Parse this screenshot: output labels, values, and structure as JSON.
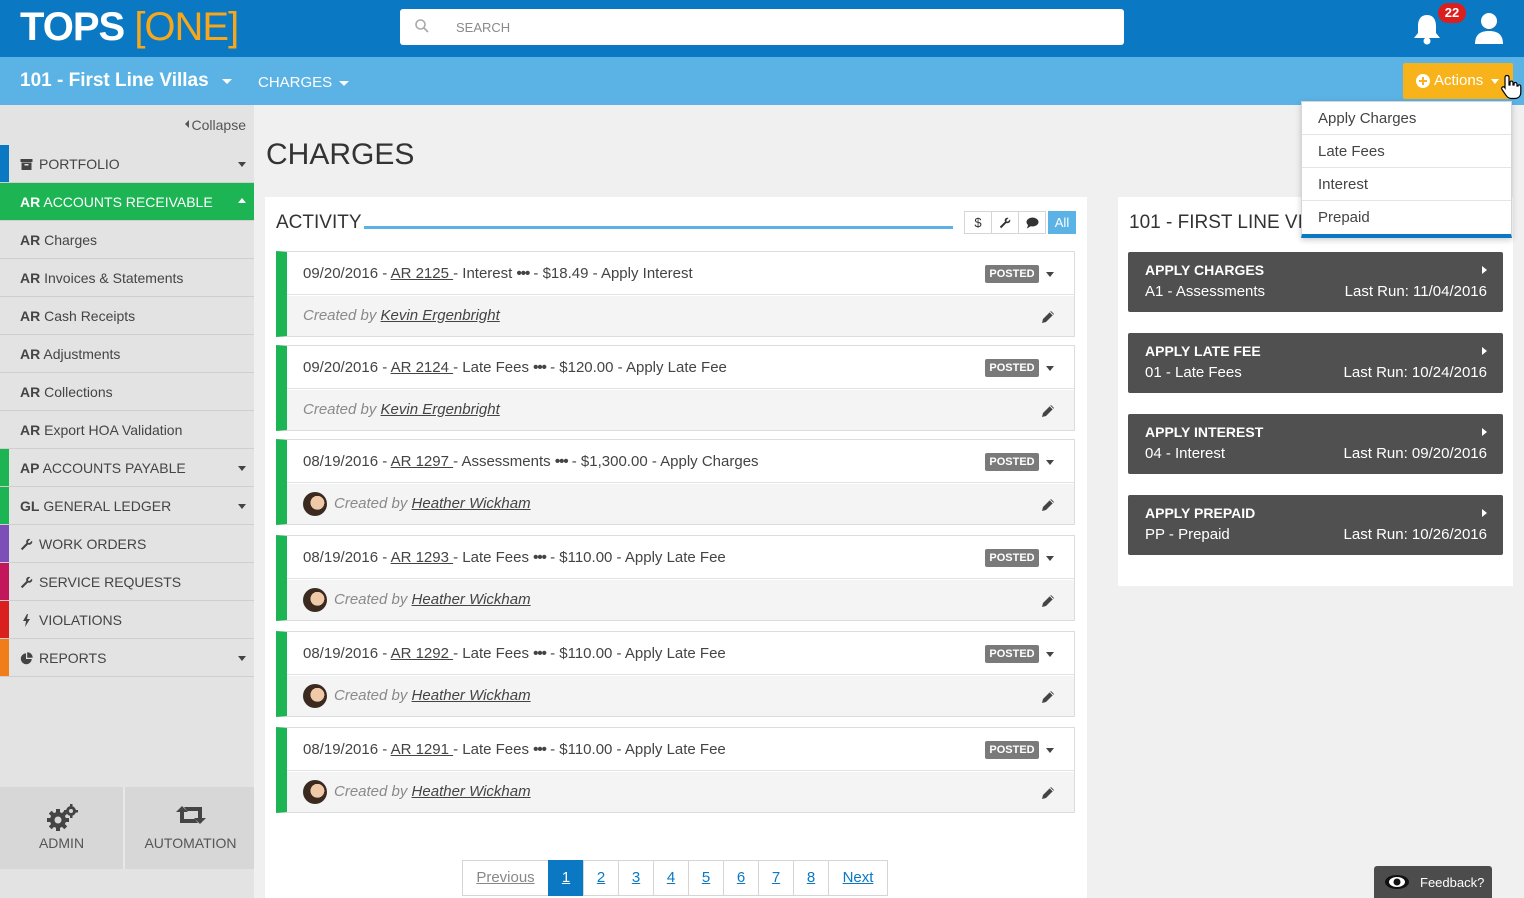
{
  "header": {
    "logo_main": "TOPS",
    "logo_one": "[ONE]",
    "search_placeholder": "SEARCH",
    "notifications": "22"
  },
  "subheader": {
    "property": "101 - First Line Villas",
    "section": "CHARGES",
    "actions_label": "Actions"
  },
  "actions_menu": [
    "Apply Charges",
    "Late Fees",
    "Interest",
    "Prepaid"
  ],
  "sidebar": {
    "collapse": "Collapse",
    "items": [
      {
        "prefix": "",
        "label": "PORTFOLIO",
        "icon": "archive-icon",
        "color": "#0a78c2",
        "dropdown": true
      },
      {
        "prefix": "AR",
        "label": "ACCOUNTS RECEIVABLE",
        "color": "#1db554",
        "dropdown": true,
        "active": true
      },
      {
        "prefix": "AR",
        "label": "Charges",
        "sub": true
      },
      {
        "prefix": "AR",
        "label": "Invoices & Statements",
        "sub": true
      },
      {
        "prefix": "AR",
        "label": "Cash Receipts",
        "sub": true
      },
      {
        "prefix": "AR",
        "label": "Adjustments",
        "sub": true
      },
      {
        "prefix": "AR",
        "label": "Collections",
        "sub": true
      },
      {
        "prefix": "AR",
        "label": "Export HOA Validation",
        "sub": true
      },
      {
        "prefix": "AP",
        "label": "ACCOUNTS PAYABLE",
        "color": "#1db554",
        "dropdown": true
      },
      {
        "prefix": "GL",
        "label": "GENERAL LEDGER",
        "color": "#1db554",
        "dropdown": true
      },
      {
        "prefix": "",
        "label": "WORK ORDERS",
        "icon": "wrench-icon",
        "color": "#7b4fb5"
      },
      {
        "prefix": "",
        "label": "SERVICE REQUESTS",
        "icon": "wrench-icon",
        "color": "#c2185b"
      },
      {
        "prefix": "",
        "label": "VIOLATIONS",
        "icon": "bolt-icon",
        "color": "#d9201e"
      },
      {
        "prefix": "",
        "label": "REPORTS",
        "icon": "pie-chart-icon",
        "color": "#f07d1a",
        "dropdown": true
      }
    ],
    "tiles": [
      {
        "label": "ADMIN",
        "icon": "gears-icon"
      },
      {
        "label": "AUTOMATION",
        "icon": "retweet-icon"
      }
    ]
  },
  "main": {
    "title": "CHARGES",
    "activity_title": "ACTIVITY",
    "filters": [
      "$",
      "wrench-icon",
      "comment-icon",
      "All"
    ],
    "entries": [
      {
        "date": "09/20/2016",
        "ref": "AR 2125",
        "type": "Interest",
        "amount": "$18.49",
        "desc": "Apply Interest",
        "status": "POSTED",
        "created_prefix": "Created by",
        "user": "Kevin Ergenbright",
        "avatar": false
      },
      {
        "date": "09/20/2016",
        "ref": "AR 2124",
        "type": "Late Fees",
        "amount": "$120.00",
        "desc": "Apply Late Fee",
        "status": "POSTED",
        "created_prefix": "Created by",
        "user": "Kevin Ergenbright",
        "avatar": false
      },
      {
        "date": "08/19/2016",
        "ref": "AR 1297",
        "type": "Assessments",
        "amount": "$1,300.00",
        "desc": "Apply Charges",
        "status": "POSTED",
        "created_prefix": "Created by",
        "user": "Heather Wickham",
        "avatar": true
      },
      {
        "date": "08/19/2016",
        "ref": "AR 1293",
        "type": "Late Fees",
        "amount": "$110.00",
        "desc": "Apply Late Fee",
        "status": "POSTED",
        "created_prefix": "Created by",
        "user": "Heather Wickham",
        "avatar": true
      },
      {
        "date": "08/19/2016",
        "ref": "AR 1292",
        "type": "Late Fees",
        "amount": "$110.00",
        "desc": "Apply Late Fee",
        "status": "POSTED",
        "created_prefix": "Created by",
        "user": "Heather Wickham",
        "avatar": true
      },
      {
        "date": "08/19/2016",
        "ref": "AR 1291",
        "type": "Late Fees",
        "amount": "$110.00",
        "desc": "Apply Late Fee",
        "status": "POSTED",
        "created_prefix": "Created by",
        "user": "Heather Wickham",
        "avatar": true
      }
    ],
    "pagination": {
      "previous": "Previous",
      "pages": [
        "1",
        "2",
        "3",
        "4",
        "5",
        "6",
        "7",
        "8"
      ],
      "current": "1",
      "next": "Next"
    }
  },
  "right_panel": {
    "title": "101 - FIRST LINE VILLAS",
    "cards": [
      {
        "title": "APPLY CHARGES",
        "sub": "A1 - Assessments",
        "last_run": "Last Run: 11/04/2016"
      },
      {
        "title": "APPLY LATE FEE",
        "sub": "01 - Late Fees",
        "last_run": "Last Run: 10/24/2016"
      },
      {
        "title": "APPLY INTEREST",
        "sub": "04 - Interest",
        "last_run": "Last Run: 09/20/2016"
      },
      {
        "title": "APPLY PREPAID",
        "sub": "PP - Prepaid",
        "last_run": "Last Run: 10/26/2016"
      }
    ]
  },
  "feedback": "Feedback?",
  "colors": {
    "header_blue": "#0a78c2",
    "subheader_blue": "#5ab3e4",
    "accent_green": "#1db554",
    "actions_yellow": "#f9b31a",
    "logo_orange": "#f6a71c",
    "badge_red": "#d9201e"
  }
}
